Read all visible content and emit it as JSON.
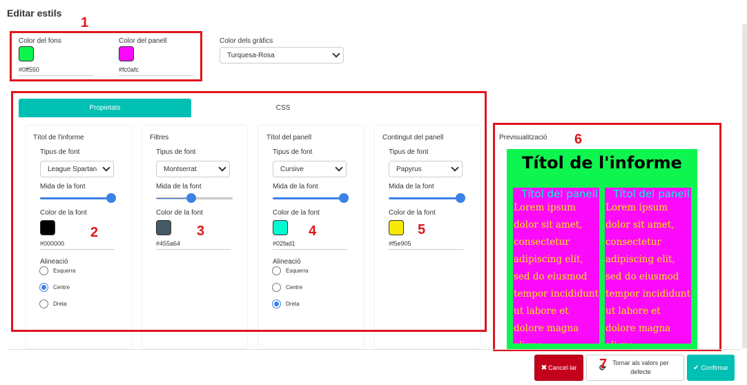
{
  "page": {
    "title": "Editar estils"
  },
  "colors": {
    "fons_label": "Color del fons",
    "fons_value": "#0ff550",
    "fons_swatch": "#0ff550",
    "panell_label": "Color del panell",
    "panell_value": "#fc0afc",
    "panell_swatch": "#fc0afc",
    "grafics_label": "Color dels gràfics",
    "grafics_value": "Turquesa-Rosa"
  },
  "tabs": {
    "properties": "Propietats",
    "css": "CSS"
  },
  "cards": [
    {
      "title": "Títol de l'informe",
      "font_type_label": "Tipus de font",
      "font": "League Spartan",
      "size_label": "Mida de la font",
      "slider_level": 1.0,
      "color_label": "Color de la font",
      "color_value": "#000000",
      "swatch": "#000000",
      "align_label": "Alineació",
      "align_options": [
        "Esquerra",
        "Centre",
        "Dreta"
      ],
      "align_selected": "Centre"
    },
    {
      "title": "Filtres",
      "font_type_label": "Tipus de font",
      "font": "Montserrat",
      "size_label": "Mida de la font",
      "slider_level": 0.45,
      "color_label": "Color de la font",
      "color_value": "#455a64",
      "swatch": "#455a64"
    },
    {
      "title": "Títol del panell",
      "font_type_label": "Tipus de font",
      "font": "Cursive",
      "size_label": "Mida de la font",
      "slider_level": 1.0,
      "color_label": "Color de la font",
      "color_value": "#02fad1",
      "swatch": "#02fad1",
      "align_label": "Alineació",
      "align_options": [
        "Esquerra",
        "Centre",
        "Dreta"
      ],
      "align_selected": "Dreta"
    },
    {
      "title": "Contingut del panell",
      "font_type_label": "Tipus de font",
      "font": "Papyrus",
      "size_label": "Mida de la font",
      "slider_level": 1.0,
      "color_label": "Color de la font",
      "color_value": "#f5e905",
      "swatch": "#f5e905"
    }
  ],
  "preview": {
    "label": "Previsualització",
    "report_title": "Títol de l'informe",
    "panel_title": "Títol del panell",
    "panel_text": "Lorem ipsum dolor sit amet, consectetur adipiscing elit, sed do eiusmod tempor incididunt ut labore et dolore magna aliqua"
  },
  "annotations": {
    "n1": "1",
    "n2": "2",
    "n3": "3",
    "n4": "4",
    "n5": "5",
    "n6": "6",
    "n7": "7"
  },
  "buttons": {
    "cancel": "Cancel·lar",
    "reset": "Tornar als valors per defecte",
    "confirm": "Confirmar"
  },
  "icons": {
    "cancel": "x-icon",
    "reset": "refresh-icon",
    "confirm": "check-icon"
  },
  "accent": {
    "teal": "#00bfb3",
    "red": "#e0141c",
    "blue": "#3b82e8",
    "cancel_bg": "#c4001a"
  }
}
